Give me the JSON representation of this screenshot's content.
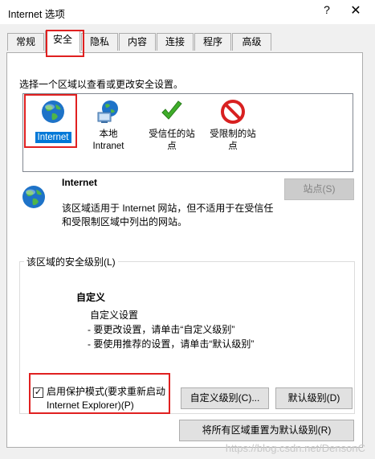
{
  "window": {
    "title": "Internet 选项",
    "help": "?",
    "close": "✕"
  },
  "tabs": [
    "常规",
    "安全",
    "隐私",
    "内容",
    "连接",
    "程序",
    "高级"
  ],
  "active_tab": "安全",
  "prompt": "选择一个区域以查看或更改安全设置。",
  "zones": [
    {
      "line1": "Internet",
      "line2": "",
      "icon": "globe-icon"
    },
    {
      "line1": "本地",
      "line2": "Intranet",
      "icon": "intranet-icon"
    },
    {
      "line1": "受信任的站",
      "line2": "点",
      "icon": "check-icon"
    },
    {
      "line1": "受限制的站",
      "line2": "点",
      "icon": "restricted-icon"
    }
  ],
  "zone_info": {
    "title": "Internet",
    "desc1": "该区域适用于 Internet 网站，但不适用于在受信任",
    "desc2": "和受限制区域中列出的网站。",
    "sites_button": "站点(S)"
  },
  "security_level": {
    "group_title": "该区域的安全级别(L)",
    "level": "自定义",
    "line1": "自定义设置",
    "line2": "- 要更改设置，请单击“自定义级别”",
    "line3": "- 要使用推荐的设置，请单击“默认级别”"
  },
  "protected_mode": {
    "label1": "启用保护模式(要求重新启动",
    "label2": "Internet Explorer)(P)",
    "checked": true,
    "check_glyph": "✓"
  },
  "buttons": {
    "custom_level": "自定义级别(C)...",
    "default_level": "默认级别(D)",
    "reset_all": "将所有区域重置为默认级别(R)"
  },
  "watermark": "https://blog.csdn.net/DensonC",
  "colors": {
    "selection": "#0078d7",
    "highlight": "#e02020"
  }
}
